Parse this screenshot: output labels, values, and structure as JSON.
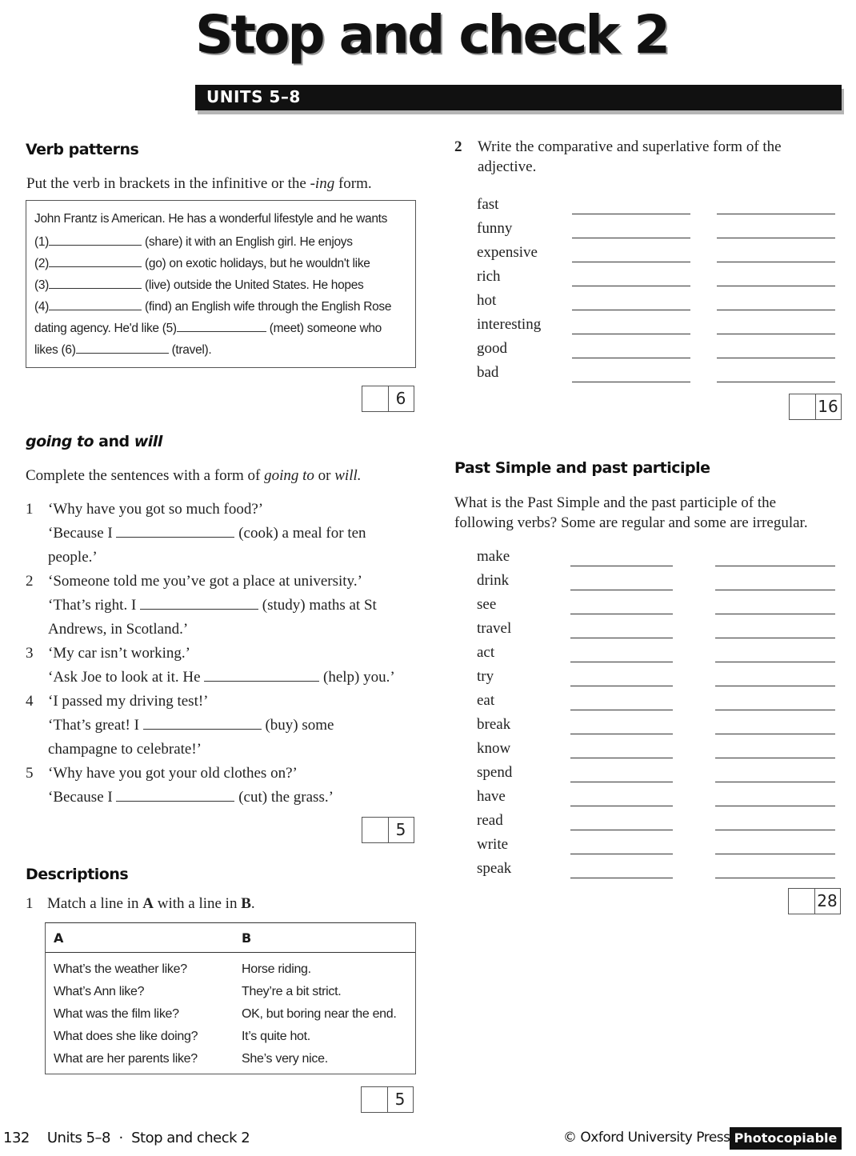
{
  "header": {
    "title": "Stop and check 2",
    "units_bar": "UNITS 5–8"
  },
  "verb_patterns": {
    "heading": "Verb patterns",
    "instruction_pre": "Put the verb in brackets in the infinitive or the ",
    "instruction_italic": "-ing",
    "instruction_post": " form.",
    "lines": [
      {
        "pre": "John Frantz is American. He has a wonderful lifestyle and he wants",
        "post": ""
      },
      {
        "pre": "(1)",
        "post": " (share) it with an English girl. He enjoys"
      },
      {
        "pre": "(2)",
        "post": " (go) on exotic holidays, but he wouldn't like"
      },
      {
        "pre": "(3)",
        "post": " (live) outside the United States. He hopes"
      },
      {
        "pre": "(4)",
        "post": " (find) an English wife through the English Rose"
      },
      {
        "pre": "dating agency. He'd like (5)",
        "post": " (meet) someone who"
      },
      {
        "pre": "likes (6)",
        "post": " (travel)."
      }
    ],
    "score_total": "6"
  },
  "going_to": {
    "heading_italic_1": "going to",
    "heading_mid": " and ",
    "heading_italic_2": "will",
    "instruction_pre": "Complete the sentences with a form of ",
    "instruction_italic_1": "going to",
    "instruction_mid": " or ",
    "instruction_italic_2": "will.",
    "items": [
      {
        "num": "1",
        "q": "‘Why have you got so much food?’",
        "a_pre": "‘Because I",
        "a_post": "(cook) a meal for ten",
        "a_cont": "people.’"
      },
      {
        "num": "2",
        "q": "‘Someone told me you’ve got a place at university.’",
        "a_pre": "‘That’s right. I",
        "a_post": "(study) maths at St",
        "a_cont": "Andrews, in Scotland.’"
      },
      {
        "num": "3",
        "q": "‘My car isn’t working.’",
        "a_pre": "‘Ask Joe to look at it. He",
        "a_post": "(help) you.’",
        "a_cont": ""
      },
      {
        "num": "4",
        "q": "‘I passed my driving test!’",
        "a_pre": "‘That’s great! I",
        "a_post": "(buy) some",
        "a_cont": "champagne to celebrate!’"
      },
      {
        "num": "5",
        "q": "‘Why have you got your old clothes on?’",
        "a_pre": "‘Because I",
        "a_post": "(cut) the grass.’",
        "a_cont": ""
      }
    ],
    "score_total": "5"
  },
  "descriptions": {
    "heading": "Descriptions",
    "ex1_num": "1",
    "ex1_instruction_pre": "Match a line in ",
    "ex1_bold_a": "A",
    "ex1_instruction_mid": " with a line in ",
    "ex1_bold_b": "B",
    "ex1_instruction_post": ".",
    "table": {
      "col_a": "A",
      "col_b": "B",
      "rows": [
        {
          "a": "What’s the weather like?",
          "b": "Horse riding."
        },
        {
          "a": "What’s Ann like?",
          "b": "They’re a bit strict."
        },
        {
          "a": "What was the film like?",
          "b": "OK, but boring near the end."
        },
        {
          "a": "What does she like doing?",
          "b": "It’s quite hot."
        },
        {
          "a": "What are her parents like?",
          "b": "She’s very nice."
        }
      ]
    },
    "ex1_score_total": "5",
    "ex2_num": "2",
    "ex2_instruction_line1": "Write the comparative and superlative form of the",
    "ex2_instruction_line2": "adjective.",
    "adjectives": [
      "fast",
      "funny",
      "expensive",
      "rich",
      "hot",
      "interesting",
      "good",
      "bad"
    ],
    "ex2_score_total": "16"
  },
  "past_simple": {
    "heading": "Past Simple and past participle",
    "instruction_line1": "What is the Past Simple and the past participle of the",
    "instruction_line2": "following verbs? Some are regular and some are irregular.",
    "verbs": [
      "make",
      "drink",
      "see",
      "travel",
      "act",
      "try",
      "eat",
      "break",
      "know",
      "spend",
      "have",
      "read",
      "write",
      "speak"
    ],
    "score_total": "28"
  },
  "footer": {
    "page_number": "132",
    "section": "Units 5–8  ·  Stop and check 2",
    "copyright": "© Oxford University Press",
    "badge": "Photocopiable"
  }
}
